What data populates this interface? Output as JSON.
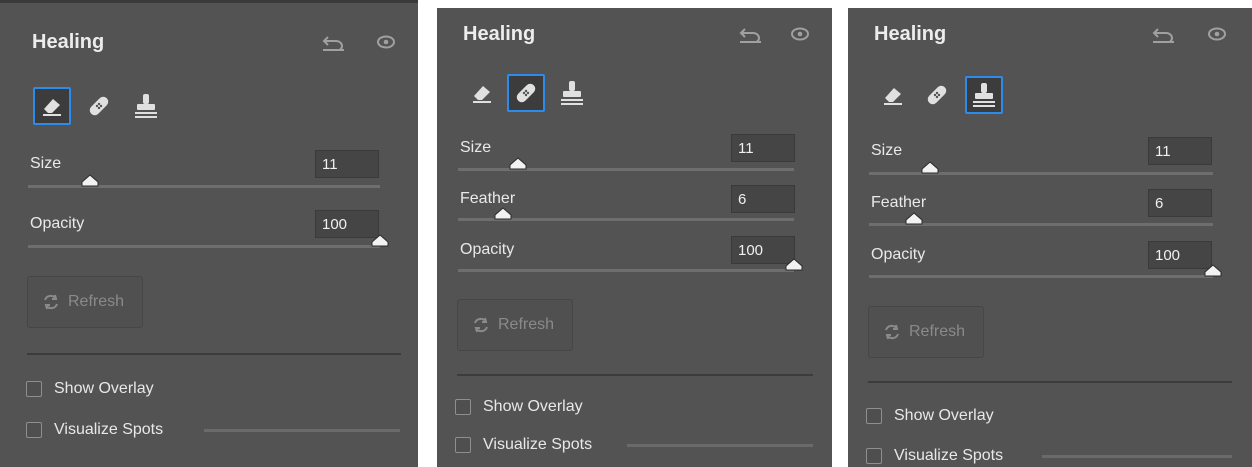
{
  "panels": [
    {
      "title": "Healing",
      "active_tool": "remove",
      "tools": [
        "eraser-icon",
        "bandage-icon",
        "stamp-icon"
      ],
      "sliders": [
        {
          "label": "Size",
          "value": "11",
          "fraction": 0.11
        },
        {
          "label": "Opacity",
          "value": "100",
          "fraction": 1.0
        }
      ],
      "refresh_label": "Refresh",
      "show_overlay_label": "Show Overlay",
      "visualize_spots_label": "Visualize Spots"
    },
    {
      "title": "Healing",
      "active_tool": "heal",
      "tools": [
        "eraser-icon",
        "bandage-icon",
        "stamp-icon"
      ],
      "sliders": [
        {
          "label": "Size",
          "value": "11",
          "fraction": 0.11
        },
        {
          "label": "Feather",
          "value": "6",
          "fraction": 0.06
        },
        {
          "label": "Opacity",
          "value": "100",
          "fraction": 1.0
        }
      ],
      "refresh_label": "Refresh",
      "show_overlay_label": "Show Overlay",
      "visualize_spots_label": "Visualize Spots"
    },
    {
      "title": "Healing",
      "active_tool": "clone",
      "tools": [
        "eraser-icon",
        "bandage-icon",
        "stamp-icon"
      ],
      "sliders": [
        {
          "label": "Size",
          "value": "11",
          "fraction": 0.11
        },
        {
          "label": "Feather",
          "value": "6",
          "fraction": 0.06
        },
        {
          "label": "Opacity",
          "value": "100",
          "fraction": 1.0
        }
      ],
      "refresh_label": "Refresh",
      "show_overlay_label": "Show Overlay",
      "visualize_spots_label": "Visualize Spots"
    }
  ],
  "colors": {
    "panel_bg": "#535353",
    "accent": "#2d8ceb"
  }
}
